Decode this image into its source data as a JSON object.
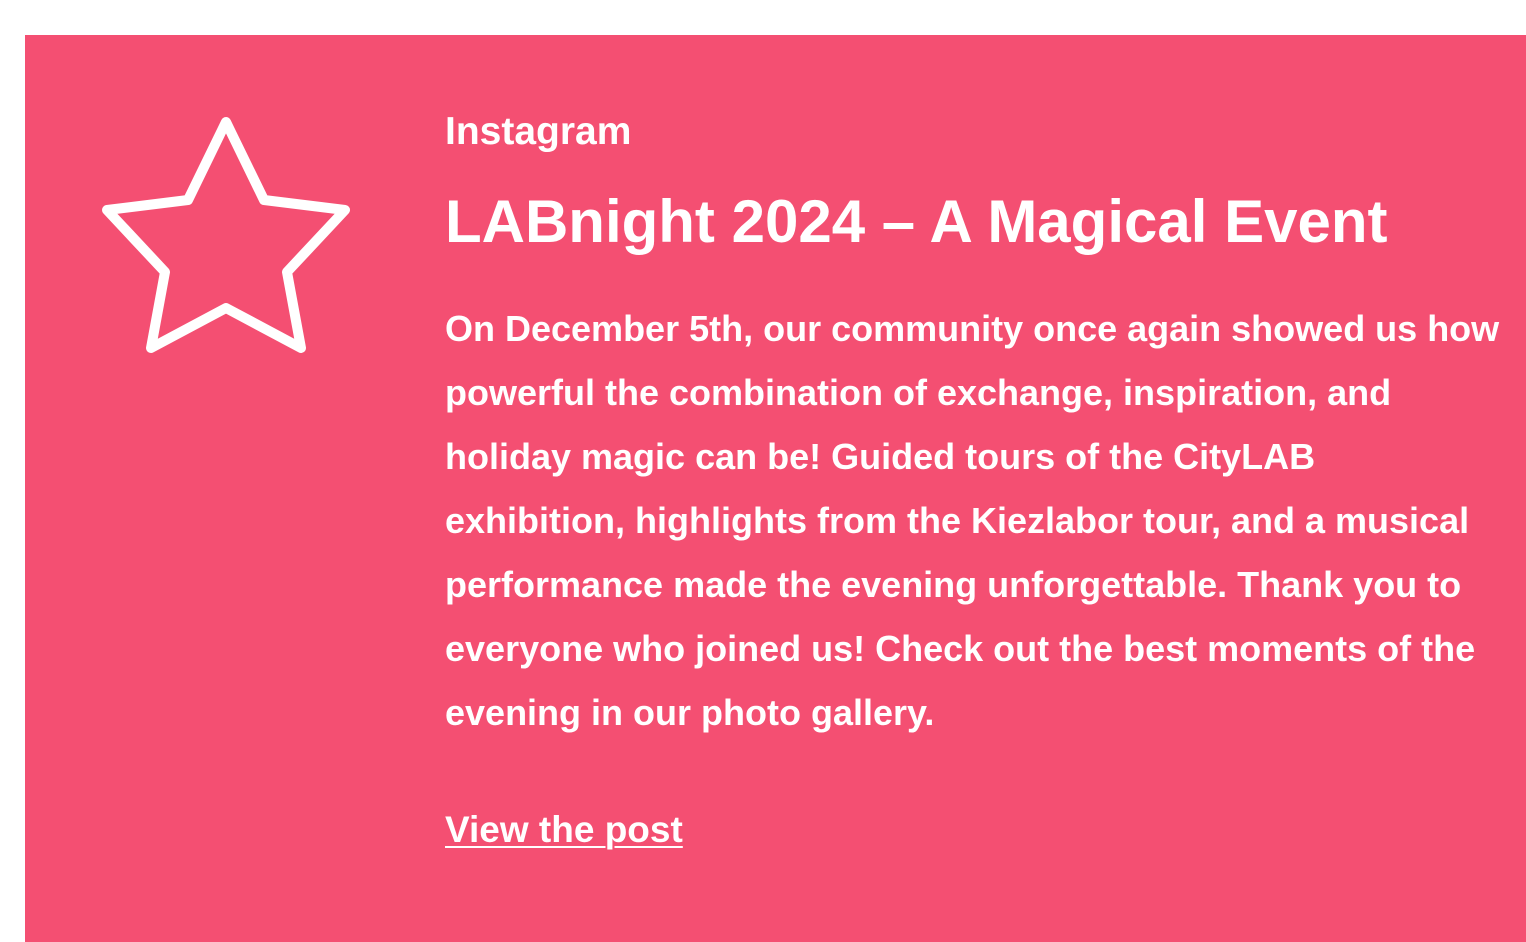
{
  "card": {
    "background": "#f44f72",
    "icon": "star-outline-icon",
    "source_label": "Instagram",
    "title": "LABnight 2024 – A Magical Event",
    "body": "On December 5th, our community once again showed us how powerful the combination of exchange, inspiration, and holiday magic can be! Guided tours of the CityLAB exhibition, highlights from the Kiezlabor tour, and a musical performance made the evening unforgettable. Thank you to everyone who joined us! Check out the best moments of the evening in our photo gallery.",
    "link_label": "View the post"
  }
}
